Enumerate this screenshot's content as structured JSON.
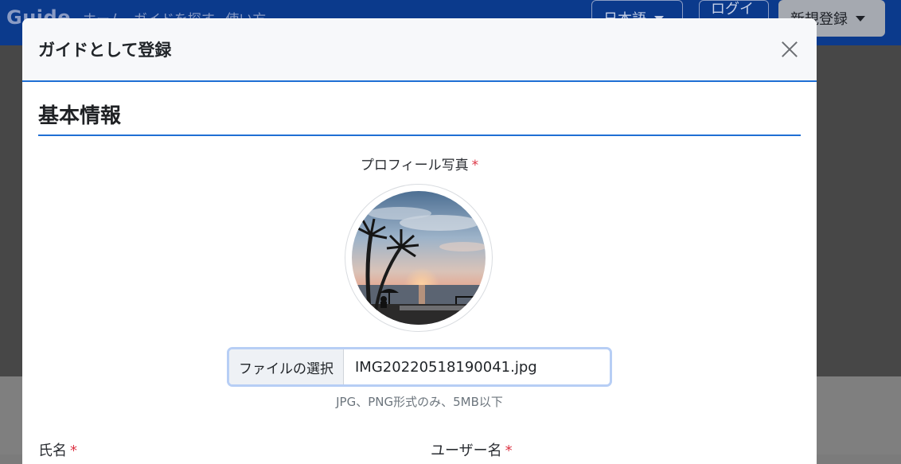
{
  "navbar": {
    "brand": "Guide",
    "links": [
      "ホーム",
      "ガイドを探す",
      "使い方"
    ],
    "language": "日本語",
    "login": "ログイン",
    "register": "新規登録"
  },
  "modal": {
    "title": "ガイドとして登録",
    "section_title": "基本情報",
    "photo_label": "プロフィール写真",
    "required_mark": "*",
    "file_button": "ファイルの選択",
    "file_name": "IMG20220518190041.jpg",
    "file_hint": "JPG、PNG形式のみ、5MB以下",
    "fields": {
      "full_name_label": "氏名",
      "username_label": "ユーザー名"
    }
  },
  "colors": {
    "accent": "#1f6fd4",
    "required": "#dc3545",
    "navbar": "#0b3a8c"
  },
  "icons": {
    "close": "close-icon",
    "caret": "caret-down-icon"
  }
}
